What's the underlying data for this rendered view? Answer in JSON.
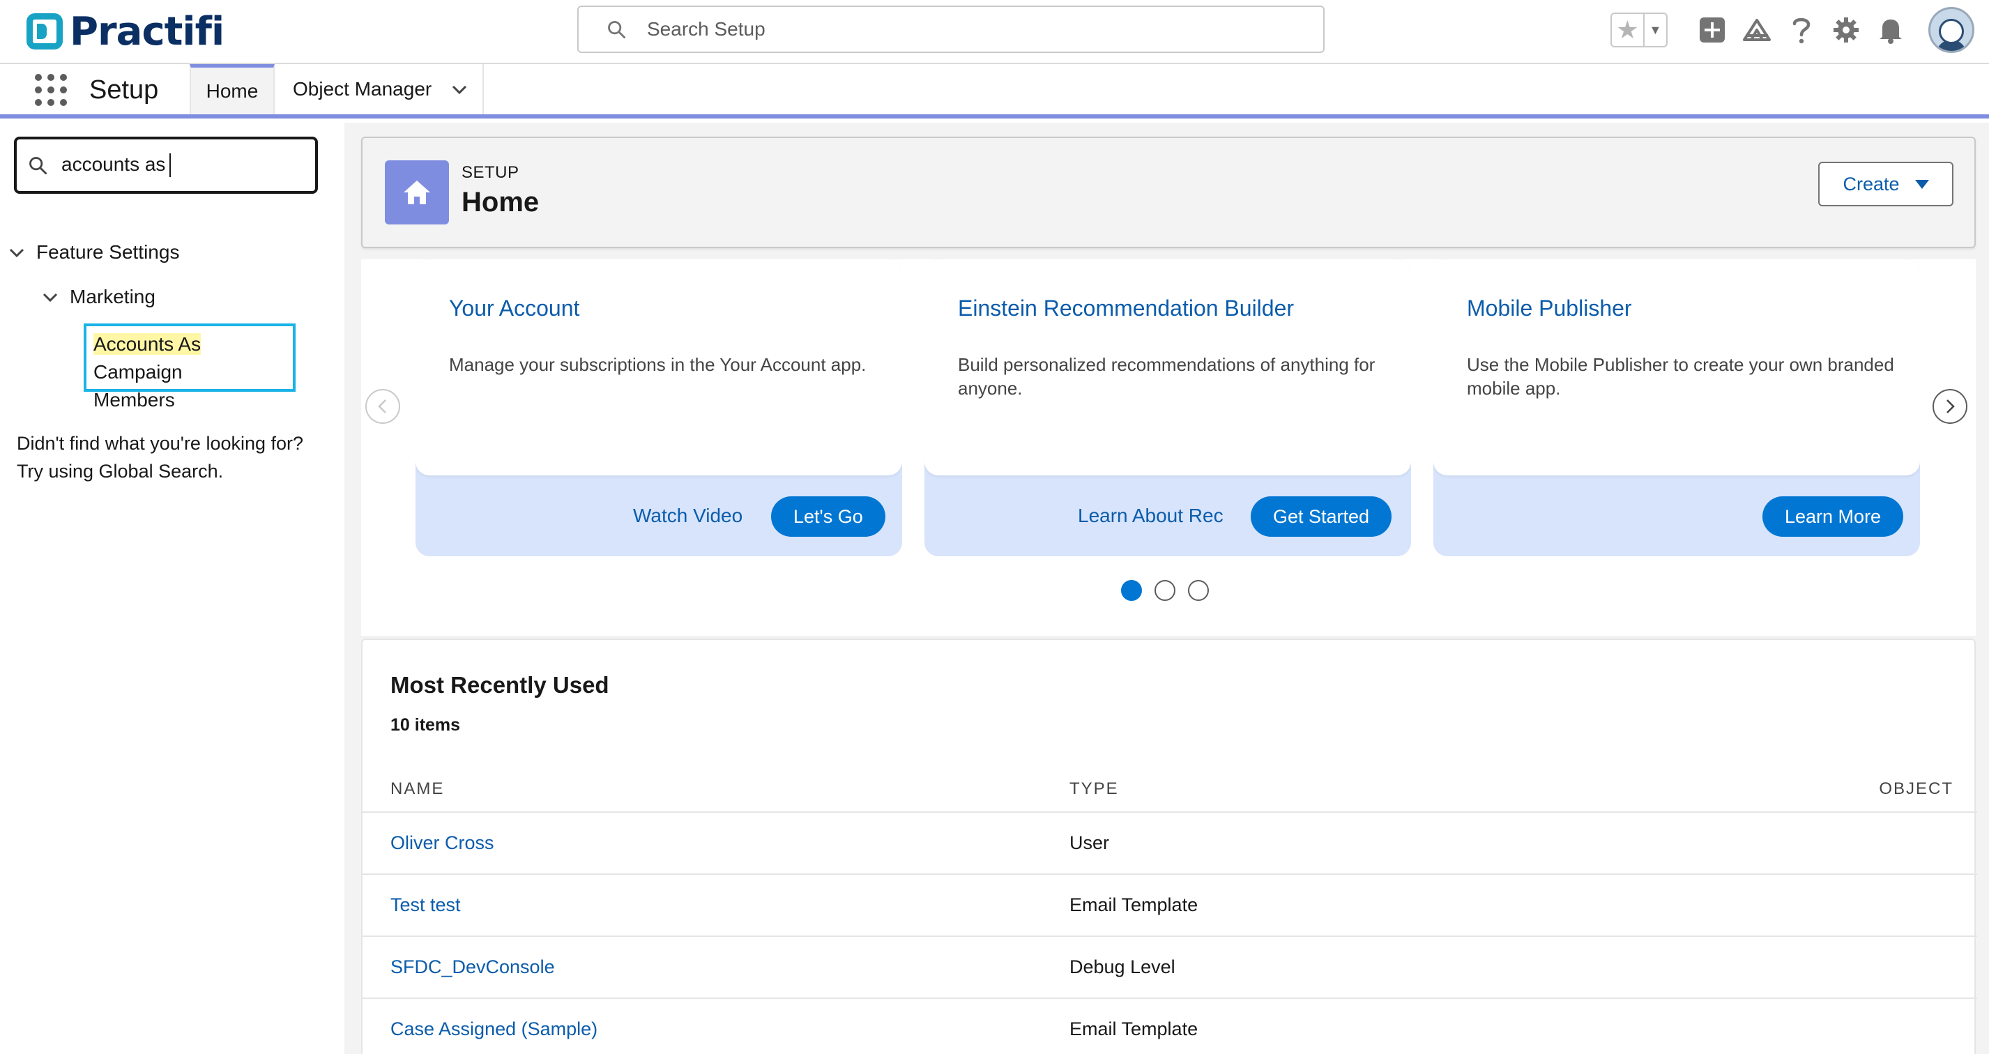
{
  "brand": {
    "name": "Practifi"
  },
  "global_search": {
    "placeholder": "Search Setup"
  },
  "header_icons": [
    "favorites-star-icon",
    "favorites-dropdown-icon",
    "global-actions-plus-icon",
    "trailhead-icon",
    "help-icon",
    "setup-gear-icon",
    "notifications-bell-icon",
    "user-avatar"
  ],
  "context_bar": {
    "app_name": "Setup",
    "tabs": [
      {
        "label": "Home",
        "active": true
      },
      {
        "label": "Object Manager",
        "has_menu": true
      }
    ]
  },
  "sidebar": {
    "quick_find_value": "accounts as",
    "tree": {
      "root": "Feature Settings",
      "child": "Marketing",
      "leaf_highlight": "Accounts As",
      "leaf_rest_line1": " Campaign",
      "leaf_line2": "Members"
    },
    "not_found_line1": "Didn't find what you're looking for?",
    "not_found_line2": "Try using Global Search."
  },
  "page_header": {
    "eyebrow": "SETUP",
    "title": "Home",
    "create_label": "Create"
  },
  "carousel": {
    "cards": [
      {
        "title": "Your Account",
        "description": "Manage your subscriptions in the Your Account app.",
        "link_label": "Watch Video",
        "button_label": "Let's Go"
      },
      {
        "title": "Einstein Recommendation Builder",
        "description": "Build personalized recommendations of anything for anyone.",
        "link_label": "Learn About Rec",
        "button_label": "Get Started"
      },
      {
        "title": "Mobile Publisher",
        "description": "Use the Mobile Publisher to create your own branded mobile app.",
        "link_label": "",
        "button_label": "Learn More"
      }
    ],
    "page_count": 3,
    "active_page": 1
  },
  "recent": {
    "title": "Most Recently Used",
    "count_label": "10 items",
    "columns": [
      "NAME",
      "TYPE",
      "OBJECT"
    ],
    "rows": [
      {
        "name": "Oliver Cross",
        "type": "User",
        "object": ""
      },
      {
        "name": "Test test",
        "type": "Email Template",
        "object": ""
      },
      {
        "name": "SFDC_DevConsole",
        "type": "Debug Level",
        "object": ""
      },
      {
        "name": "Case Assigned (Sample)",
        "type": "Email Template",
        "object": ""
      }
    ]
  },
  "colors": {
    "accent": "#7f8de1",
    "brand_button": "#0176d3",
    "link": "#0b5cab",
    "quickfind_highlight_border": "#1ab3e6",
    "logo_text": "#0b2f63",
    "logo_mark": "#18a3c4"
  }
}
